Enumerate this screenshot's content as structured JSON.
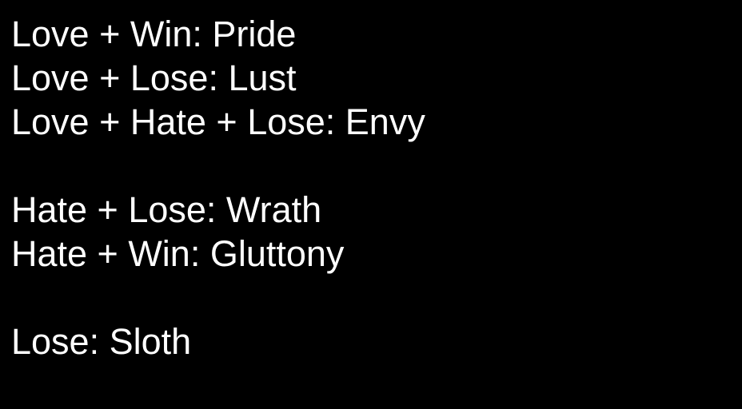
{
  "background_color": "#000000",
  "text_color": "#ffffff",
  "groups": [
    {
      "lines": [
        "Love + Win: Pride",
        "Love + Lose: Lust",
        "Love + Hate + Lose: Envy"
      ]
    },
    {
      "lines": [
        "Hate + Lose: Wrath",
        "Hate + Win: Gluttony"
      ]
    },
    {
      "lines": [
        "Lose: Sloth"
      ]
    }
  ]
}
